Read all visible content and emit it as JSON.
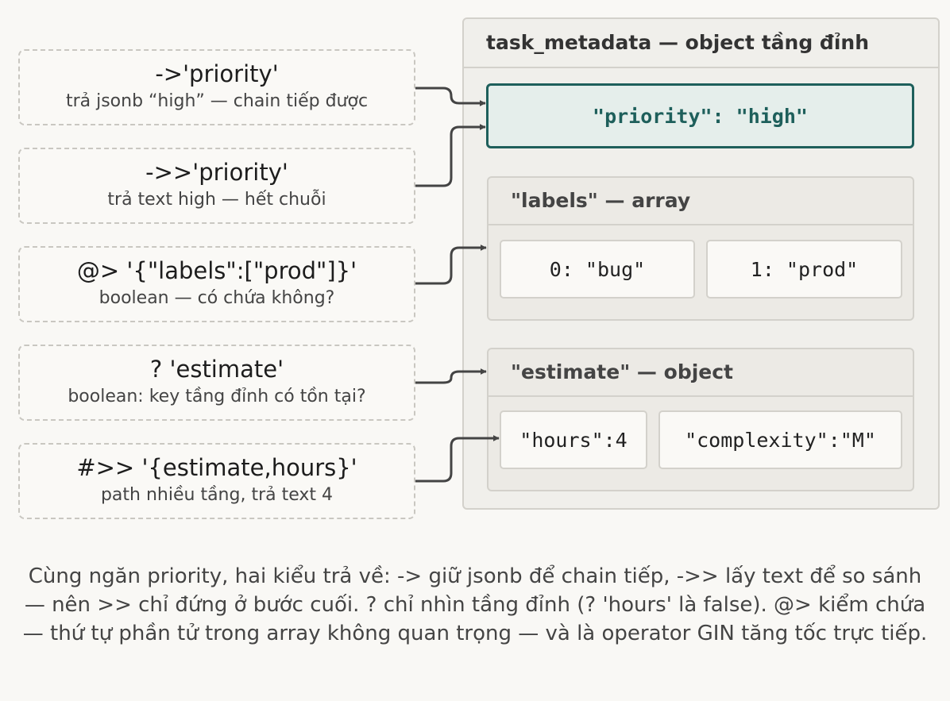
{
  "operators": [
    {
      "op": "->'priority'",
      "desc": "trả jsonb “high” — chain tiếp được"
    },
    {
      "op": "->>'priority'",
      "desc": "trả text high — hết chuỗi"
    },
    {
      "op": "@> '{\"labels\":[\"prod\"]}'",
      "desc": "boolean — có chứa không?"
    },
    {
      "op": "? 'estimate'",
      "desc": "boolean: key tầng đỉnh có tồn tại?"
    },
    {
      "op": "#>> '{estimate,hours}'",
      "desc": "path nhiều tầng, trả text 4"
    }
  ],
  "object": {
    "title": "task_metadata — object tầng đỉnh",
    "priority_entry": "\"priority\": \"high\"",
    "labels": {
      "title": "\"labels\" — array",
      "items": [
        "0: \"bug\"",
        "1: \"prod\""
      ]
    },
    "estimate": {
      "title": "\"estimate\" — object",
      "items": [
        "\"hours\":4",
        "\"complexity\":\"M\""
      ]
    }
  },
  "caption": "Cùng ngăn priority, hai kiểu trả về: -> giữ jsonb để chain tiếp, ->> lấy text để so sánh — nên >> chỉ đứng ở bước cuối. ? chỉ nhìn tầng đỉnh (? 'hours' là false). @> kiểm chứa — thứ tự phần tử trong array không quan trọng — và là operator GIN tăng tốc trực tiếp.",
  "colors": {
    "accent": "#1e5f5b",
    "border": "#d3d1cb",
    "arrow": "#444444"
  }
}
